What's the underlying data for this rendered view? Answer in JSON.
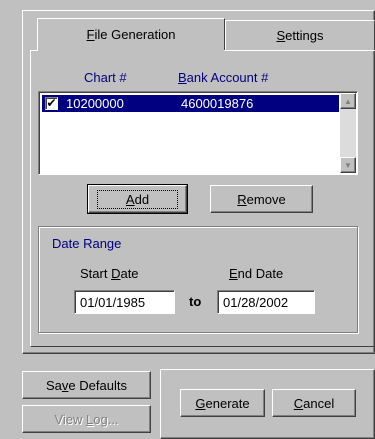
{
  "tabs": {
    "file_generation": {
      "pre": "",
      "key": "F",
      "post": "ile Generation"
    },
    "settings": {
      "pre": "",
      "key": "S",
      "post": "ettings"
    }
  },
  "list": {
    "headers": {
      "chart": "Chart #",
      "bank_pre": "",
      "bank_key": "B",
      "bank_post": "ank Account #"
    },
    "rows": [
      {
        "checked": true,
        "check_glyph": "✔",
        "chart": "10200000",
        "bank_account": "4600019876"
      }
    ],
    "scroll_up_glyph": "▲",
    "scroll_down_glyph": "▼"
  },
  "buttons": {
    "add": {
      "pre": "",
      "key": "A",
      "post": "dd"
    },
    "remove": {
      "pre": "",
      "key": "R",
      "post": "emove"
    },
    "save_defaults": {
      "pre": "Sa",
      "key": "v",
      "post": "e Defaults"
    },
    "view_log": {
      "pre": "View ",
      "key": "L",
      "post": "og..."
    },
    "generate": {
      "pre": "",
      "key": "G",
      "post": "enerate"
    },
    "cancel": {
      "pre": "",
      "key": "C",
      "post": "ancel"
    }
  },
  "date_range": {
    "title": "Date Range",
    "start_label": {
      "pre": "Start ",
      "key": "D",
      "post": "ate"
    },
    "end_label": {
      "pre": "",
      "key": "E",
      "post": "nd Date"
    },
    "to_label": "to",
    "start_value": "01/01/1985",
    "end_value": "01/28/2002"
  },
  "colors": {
    "face": "#c0c0c0",
    "highlight_row": "#000080",
    "label_blue": "#000080"
  }
}
